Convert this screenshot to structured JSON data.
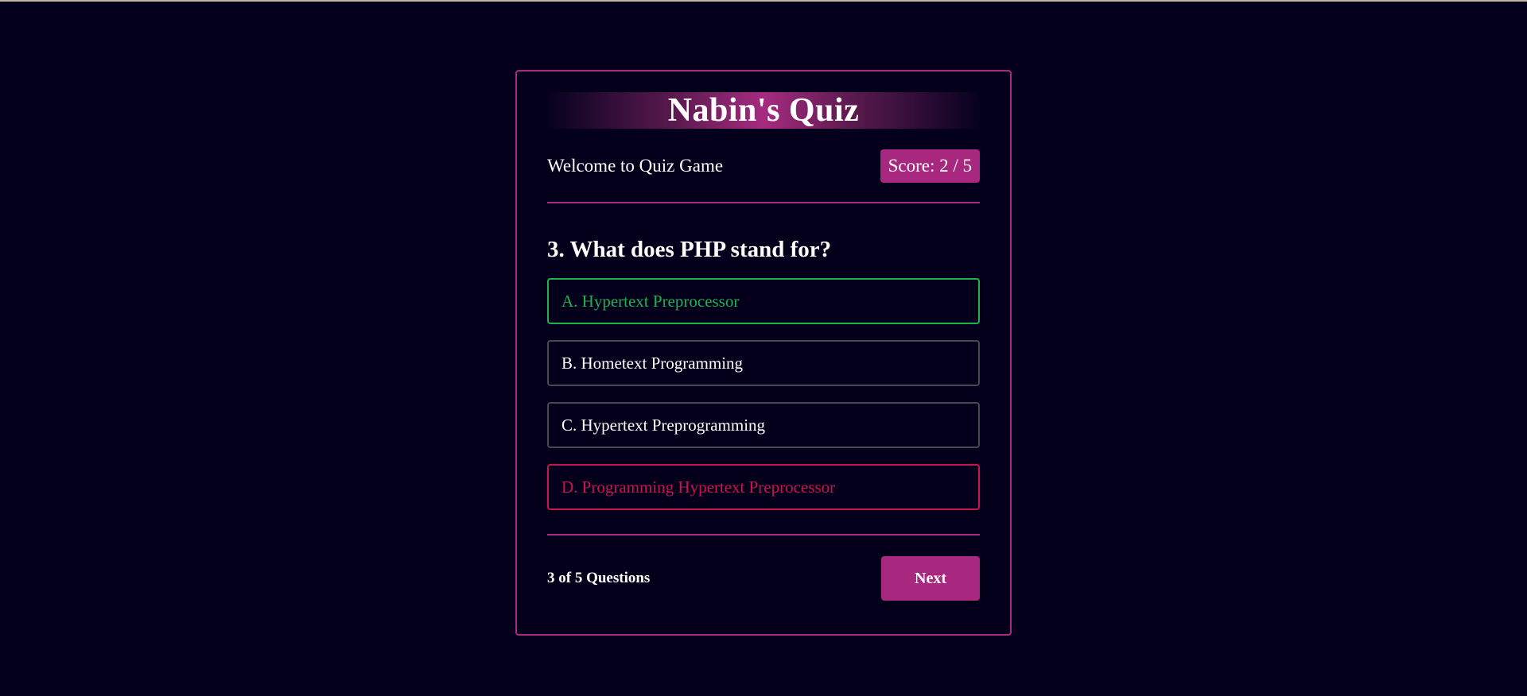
{
  "app": {
    "title": "Nabin's Quiz"
  },
  "header": {
    "welcome": "Welcome to Quiz Game",
    "score_label": "Score: 2 / 5"
  },
  "question": {
    "text": "3. What does PHP stand for?",
    "options": [
      {
        "label": "A. Hypertext Preprocessor",
        "state": "correct"
      },
      {
        "label": "B. Hometext Programming",
        "state": "neutral"
      },
      {
        "label": "C. Hypertext Preprogramming",
        "state": "neutral"
      },
      {
        "label": "D. Programming Hypertext Preprocessor",
        "state": "wrong"
      }
    ]
  },
  "footer": {
    "progress": "3 of 5 Questions",
    "next_label": "Next"
  },
  "colors": {
    "background": "#04001c",
    "accent": "#a8287f",
    "correct": "#1bb34f",
    "wrong": "#c8154c",
    "neutral_border": "#4a4658"
  }
}
